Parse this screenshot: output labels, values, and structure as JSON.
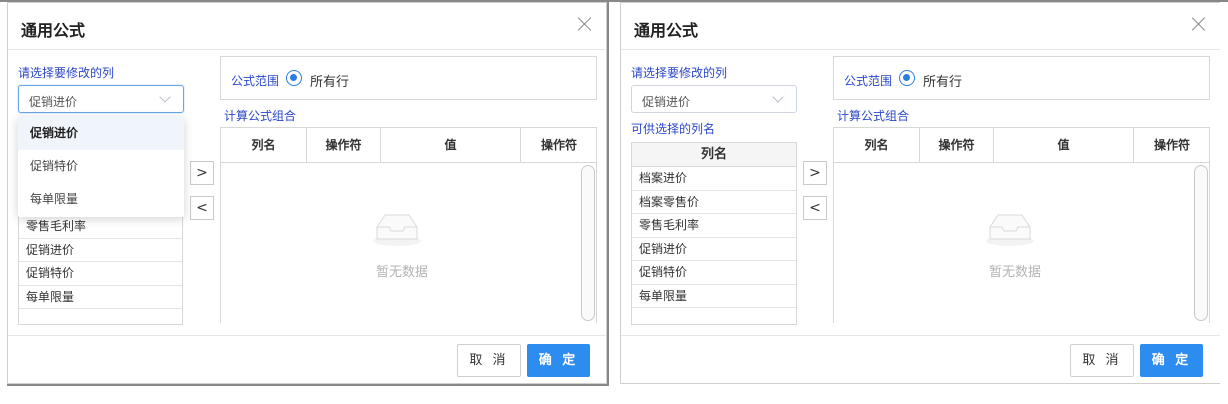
{
  "dialog_title": "通用公式",
  "left_panel": {
    "select_label": "请选择要修改的列",
    "select_value": "促销进价",
    "dropdown_options": [
      {
        "label": "促销进价",
        "selected": true
      },
      {
        "label": "促销特价",
        "selected": false
      },
      {
        "label": "每单限量",
        "selected": false
      }
    ],
    "visible_columns": [
      "零售毛利率",
      "促销进价",
      "促销特价",
      "每单限量"
    ]
  },
  "right_panel": {
    "select_label": "请选择要修改的列",
    "select_value": "促销进价",
    "available_label": "可供选择的列名",
    "columns_header": "列名",
    "columns": [
      "档案进价",
      "档案零售价",
      "零售毛利率",
      "促销进价",
      "促销特价",
      "每单限量"
    ]
  },
  "move_right_label": ">",
  "move_left_label": "<",
  "scope": {
    "label": "公式范围",
    "option": "所有行",
    "selected": true
  },
  "combo_label": "计算公式组合",
  "table_headers": [
    "列名",
    "操作符",
    "值",
    "操作符"
  ],
  "empty_text": "暂无数据",
  "buttons": {
    "cancel": "取 消",
    "ok": "确 定"
  },
  "colors": {
    "accent": "#2d8cf0",
    "label_blue": "#2b47c9"
  },
  "icons": {
    "close": "close-icon",
    "empty": "empty-inbox-icon",
    "dropdown": "chevron-down-icon"
  }
}
